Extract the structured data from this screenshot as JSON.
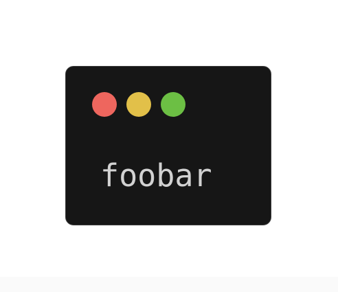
{
  "window": {
    "background": "#161616",
    "border": "#3c3c3c",
    "controls": [
      {
        "name": "close",
        "color": "#ee665e",
        "icon": "close-dot"
      },
      {
        "name": "minimize",
        "color": "#e2c049",
        "icon": "minimize-dot"
      },
      {
        "name": "maximize",
        "color": "#6cbf44",
        "icon": "maximize-dot"
      }
    ]
  },
  "terminal": {
    "text": "foobar",
    "text_color": "#d2d2d2"
  }
}
